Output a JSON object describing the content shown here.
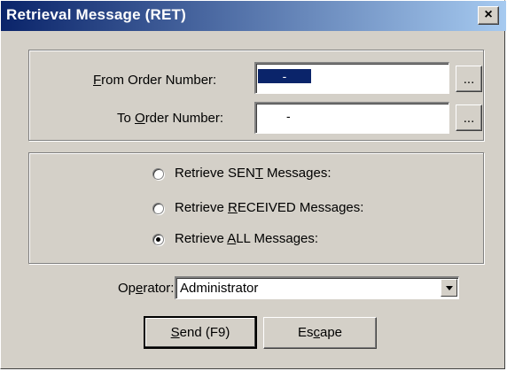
{
  "window": {
    "title": "Retrieval Message (RET)",
    "close_label": "×"
  },
  "order_range": {
    "from_label_pre": "",
    "from_label_ul": "F",
    "from_label_post": "rom Order Number:",
    "from_value": "-",
    "to_label_pre": "To ",
    "to_label_ul": "O",
    "to_label_post": "rder Number:",
    "to_value": "-",
    "browse_label": "..."
  },
  "retrieve_options": [
    {
      "pre": "Retrieve SEN",
      "ul": "T",
      "post": " Messages:",
      "selected": false
    },
    {
      "pre": "Retrieve ",
      "ul": "R",
      "post": "ECEIVED Messages:",
      "selected": false
    },
    {
      "pre": "Retrieve ",
      "ul": "A",
      "post": "LL Messages:",
      "selected": true
    }
  ],
  "operator": {
    "label_pre": "Op",
    "label_ul": "e",
    "label_post": "rator:",
    "value": "Administrator"
  },
  "buttons": {
    "send_ul": "S",
    "send_post": "end (F9)",
    "escape_pre": "Es",
    "escape_ul": "c",
    "escape_post": "ape"
  }
}
